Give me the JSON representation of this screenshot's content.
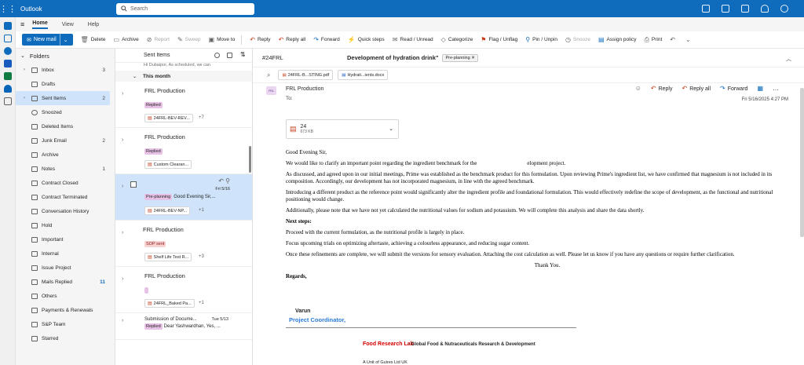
{
  "app": {
    "name": "Outlook",
    "search_placeholder": "Search"
  },
  "tabs": [
    "Home",
    "View",
    "Help"
  ],
  "ribbon": {
    "new_mail": "New mail",
    "buttons": [
      {
        "label": "Delete",
        "icon": "trash-icon",
        "enabled": true
      },
      {
        "label": "Archive",
        "icon": "archive-icon",
        "enabled": true
      },
      {
        "label": "Report",
        "icon": "report-icon",
        "enabled": false
      },
      {
        "label": "Sweep",
        "icon": "sweep-icon",
        "enabled": false
      },
      {
        "label": "Move to",
        "icon": "move-icon",
        "enabled": true
      },
      {
        "label": "Reply",
        "icon": "reply-icon",
        "enabled": true
      },
      {
        "label": "Reply all",
        "icon": "reply-all-icon",
        "enabled": true
      },
      {
        "label": "Forward",
        "icon": "forward-icon",
        "enabled": true
      },
      {
        "label": "Quick steps",
        "icon": "quick-steps-icon",
        "enabled": true
      },
      {
        "label": "Read / Unread",
        "icon": "envelope-icon",
        "enabled": true
      },
      {
        "label": "Categorize",
        "icon": "tag-icon",
        "enabled": true
      },
      {
        "label": "Flag / Unflag",
        "icon": "flag-icon",
        "enabled": true
      },
      {
        "label": "Pin / Unpin",
        "icon": "pin-icon",
        "enabled": true
      },
      {
        "label": "Snooze",
        "icon": "clock-icon",
        "enabled": false
      },
      {
        "label": "Assign policy",
        "icon": "policy-icon",
        "enabled": true
      },
      {
        "label": "Print",
        "icon": "print-icon",
        "enabled": true
      }
    ]
  },
  "folders": {
    "header": "Folders",
    "items": [
      {
        "label": "Inbox",
        "count": "3",
        "expandable": true
      },
      {
        "label": "Drafts",
        "count": "",
        "expandable": false
      },
      {
        "label": "Sent Items",
        "count": "2",
        "expandable": true,
        "selected": true
      },
      {
        "label": "Snoozed",
        "count": "",
        "expandable": false
      },
      {
        "label": "Deleted Items",
        "count": "",
        "expandable": false
      },
      {
        "label": "Junk Email",
        "count": "2",
        "expandable": false
      },
      {
        "label": "Archive",
        "count": "",
        "expandable": false
      },
      {
        "label": "Notes",
        "count": "1",
        "expandable": false
      },
      {
        "label": "Contract Closed",
        "count": "",
        "expandable": false
      },
      {
        "label": "Contract Terminated",
        "count": "",
        "expandable": false
      },
      {
        "label": "Conversation History",
        "count": "",
        "expandable": false
      },
      {
        "label": "Hold",
        "count": "",
        "expandable": false
      },
      {
        "label": "Important",
        "count": "",
        "expandable": false
      },
      {
        "label": "Internal",
        "count": "",
        "expandable": false
      },
      {
        "label": "Issue Project",
        "count": "",
        "expandable": false
      },
      {
        "label": "Mails Replied",
        "count": "11",
        "expandable": false,
        "highlight": true
      },
      {
        "label": "Others",
        "count": "",
        "expandable": false
      },
      {
        "label": "Payments & Renewals",
        "count": "",
        "expandable": false
      },
      {
        "label": "S&P Team",
        "count": "",
        "expandable": false
      },
      {
        "label": "Starred",
        "count": "",
        "expandable": false
      }
    ]
  },
  "message_list": {
    "title": "Sent Items",
    "truncated_top": "Hi Dubaipor, As scheduled, we can",
    "group": "This month",
    "items": [
      {
        "sender": "FRL Production",
        "tag": "Replied",
        "tag_style": "purple",
        "attachment": "24FRL-BEV-REV...",
        "more": "+7"
      },
      {
        "sender": "FRL Production",
        "tag": "Replied",
        "tag_style": "purple",
        "attachment": "Custom Clearan...",
        "more": ""
      },
      {
        "sender": "",
        "tag": "Pre-planning",
        "tag_style": "purple",
        "preview": "Good Evening Sir,...",
        "date": "Fri 5/16",
        "attachment": "24FRL-BEV-NP...",
        "more": "+1",
        "selected": true
      },
      {
        "sender": "FRL Production",
        "tag": "SOP sent",
        "tag_style": "red",
        "attachment": "Shelf Life Test R...",
        "more": "+3"
      },
      {
        "sender": "FRL Production",
        "tag": "",
        "tag_style": "purple",
        "attachment": "24FRL_Baked Pa...",
        "more": "+1"
      },
      {
        "subject": "Submission of Docume...",
        "date": "Tue 5/13",
        "tag": "Replied",
        "preview": "Dear Yashwardhan, Yes, ..."
      }
    ]
  },
  "reading": {
    "thread_id": "#24FRL",
    "subject": "Development of hydration drink\"",
    "category": "Pre-planning",
    "attachments": [
      {
        "name": "24FRL-B...STING.pdf",
        "type": "pdf"
      },
      {
        "name": "Hydrati...ients.docx",
        "type": "docx"
      }
    ],
    "from": "FRL Production",
    "to_label": "To:",
    "avatar_text": "FRL",
    "actions": [
      "Reply",
      "Reply all",
      "Forward"
    ],
    "date": "Fri 5/16/2025 4:27 PM",
    "body_attachment": {
      "name": "24",
      "size": "673 KB"
    },
    "body": {
      "greeting": "Good Evening Sir,",
      "p1a": "We would like to clarify an important point regarding the ingredient benchmark for the",
      "p1b": "elopment project.",
      "p2": "As discussed, and agreed upon in our initial meetings, Prime was established as the benchmark product for this formulation. Upon reviewing Prime's ingredient list, we have confirmed that magnesium is not included in its composition. Accordingly, our development has not incorporated magnesium, in line with the agreed benchmark.",
      "p3": "Introducing a different product as the reference point would significantly alter the ingredient profile and foundational formulation. This would effectively redefine the scope of development, as the functional and nutritional positioning would change.",
      "p4": "Additionally, please note that we have not yet calculated the nutritional values for sodium and potassium. We will complete this analysis and share the data shortly.",
      "next_steps": "Next steps:",
      "p5": "Proceed with the current formulation, as the nutritional profile is largely in place.",
      "p6": "Focus upcoming trials on optimizing aftertaste, achieving a colourless appearance, and reducing sugar content.",
      "p7": "Once these refinements are complete, we will submit the versions for sensory evaluation. Attaching the cost calculation as well. Please let us know if you have any questions or require further clarification.",
      "thanks": "Thank You.",
      "regards": "Regards,"
    },
    "signature": {
      "name": "Varun",
      "role": "Project Coordinator,",
      "lab": "Food Research Lab",
      "tagline": "- Global Food & Nutraceuticals Research & Development",
      "unit": "A Unit of Guires Ltd UK"
    }
  }
}
